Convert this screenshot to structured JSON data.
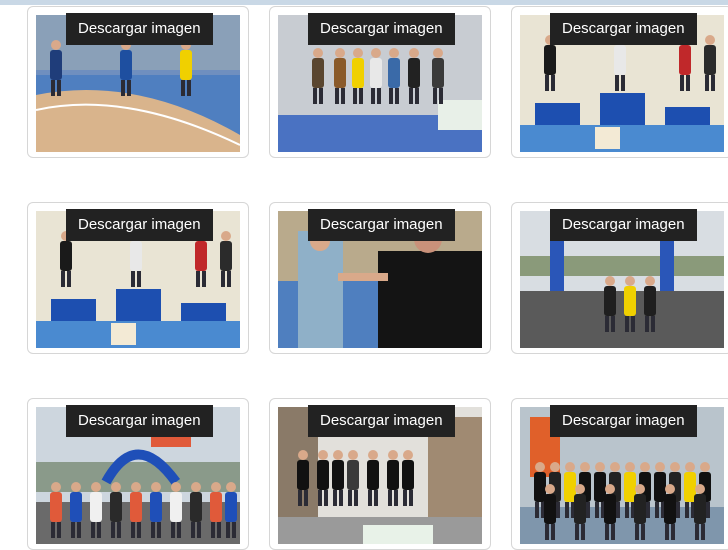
{
  "gallery": {
    "items": [
      {
        "button_label": "Descargar imagen",
        "scene": "track-race"
      },
      {
        "button_label": "Descargar imagen",
        "scene": "podium-group"
      },
      {
        "button_label": "Descargar imagen",
        "scene": "podium-ceremony"
      },
      {
        "button_label": "Descargar imagen",
        "scene": "podium-ceremony"
      },
      {
        "button_label": "Descargar imagen",
        "scene": "handshake"
      },
      {
        "button_label": "Descargar imagen",
        "scene": "outdoor-finish"
      },
      {
        "button_label": "Descargar imagen",
        "scene": "race-start"
      },
      {
        "button_label": "Descargar imagen",
        "scene": "street-group"
      },
      {
        "button_label": "Descargar imagen",
        "scene": "volunteers-group"
      }
    ]
  },
  "colors": {
    "button_bg": "#222222",
    "button_text": "#ffffff",
    "card_border": "#d6d6d6"
  }
}
